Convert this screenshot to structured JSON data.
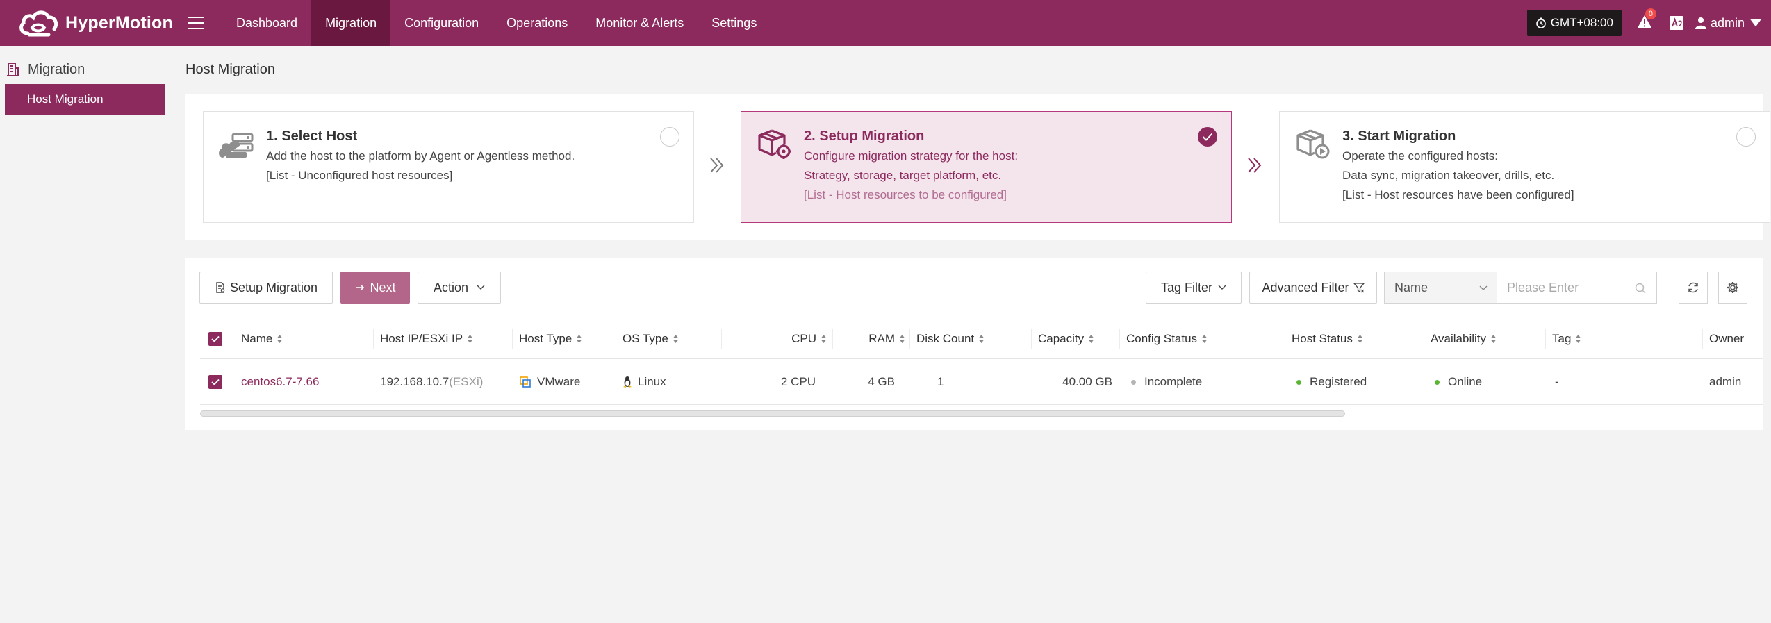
{
  "app": {
    "name": "HyperMotion"
  },
  "nav": {
    "items": [
      {
        "label": "Dashboard"
      },
      {
        "label": "Migration",
        "active": true
      },
      {
        "label": "Configuration"
      },
      {
        "label": "Operations"
      },
      {
        "label": "Monitor & Alerts"
      },
      {
        "label": "Settings"
      }
    ]
  },
  "topbar": {
    "timezone": "GMT+08:00",
    "alert_count": "0",
    "user": "admin"
  },
  "sidebar": {
    "section": "Migration",
    "items": [
      {
        "label": "Host Migration",
        "active": true
      }
    ]
  },
  "page": {
    "title": "Host Migration"
  },
  "steps": [
    {
      "title": "1. Select Host",
      "lines": [
        "Add the host to the platform by Agent or Agentless method.",
        "[List - Unconfigured host resources]"
      ],
      "active": false
    },
    {
      "title": "2. Setup Migration",
      "lines": [
        "Configure migration strategy for the host:",
        "Strategy, storage, target platform, etc.",
        "[List - Host resources to be configured]"
      ],
      "active": true
    },
    {
      "title": "3. Start Migration",
      "lines": [
        "Operate the configured hosts:",
        "Data sync, migration takeover, drills, etc.",
        "[List - Host resources have been configured]"
      ],
      "active": false
    }
  ],
  "toolbar": {
    "setup_migration": "Setup Migration",
    "next": "Next",
    "action": "Action",
    "tag_filter": "Tag Filter",
    "advanced_filter": "Advanced Filter",
    "search_field": "Name",
    "search_placeholder": "Please Enter"
  },
  "table": {
    "columns": [
      "Name",
      "Host IP/ESXi IP",
      "Host Type",
      "OS Type",
      "CPU",
      "RAM",
      "Disk Count",
      "Capacity",
      "Config Status",
      "Host Status",
      "Availability",
      "Tag",
      "Owner"
    ],
    "rows": [
      {
        "name": "centos6.7-7.66",
        "ip": "192.168.10.7",
        "ip_suffix": "(ESXi)",
        "host_type": "VMware",
        "os_type": "Linux",
        "cpu": "2 CPU",
        "ram": "4 GB",
        "disk_count": "1",
        "capacity": "40.00 GB",
        "config_status": "Incomplete",
        "host_status": "Registered",
        "availability": "Online",
        "tag": "-",
        "owner": "admin"
      }
    ]
  },
  "colors": {
    "brand": "#8c2a5e",
    "brand_dark": "#6b1840",
    "status_gray": "#b5b5b5",
    "status_green": "#5cb531"
  }
}
